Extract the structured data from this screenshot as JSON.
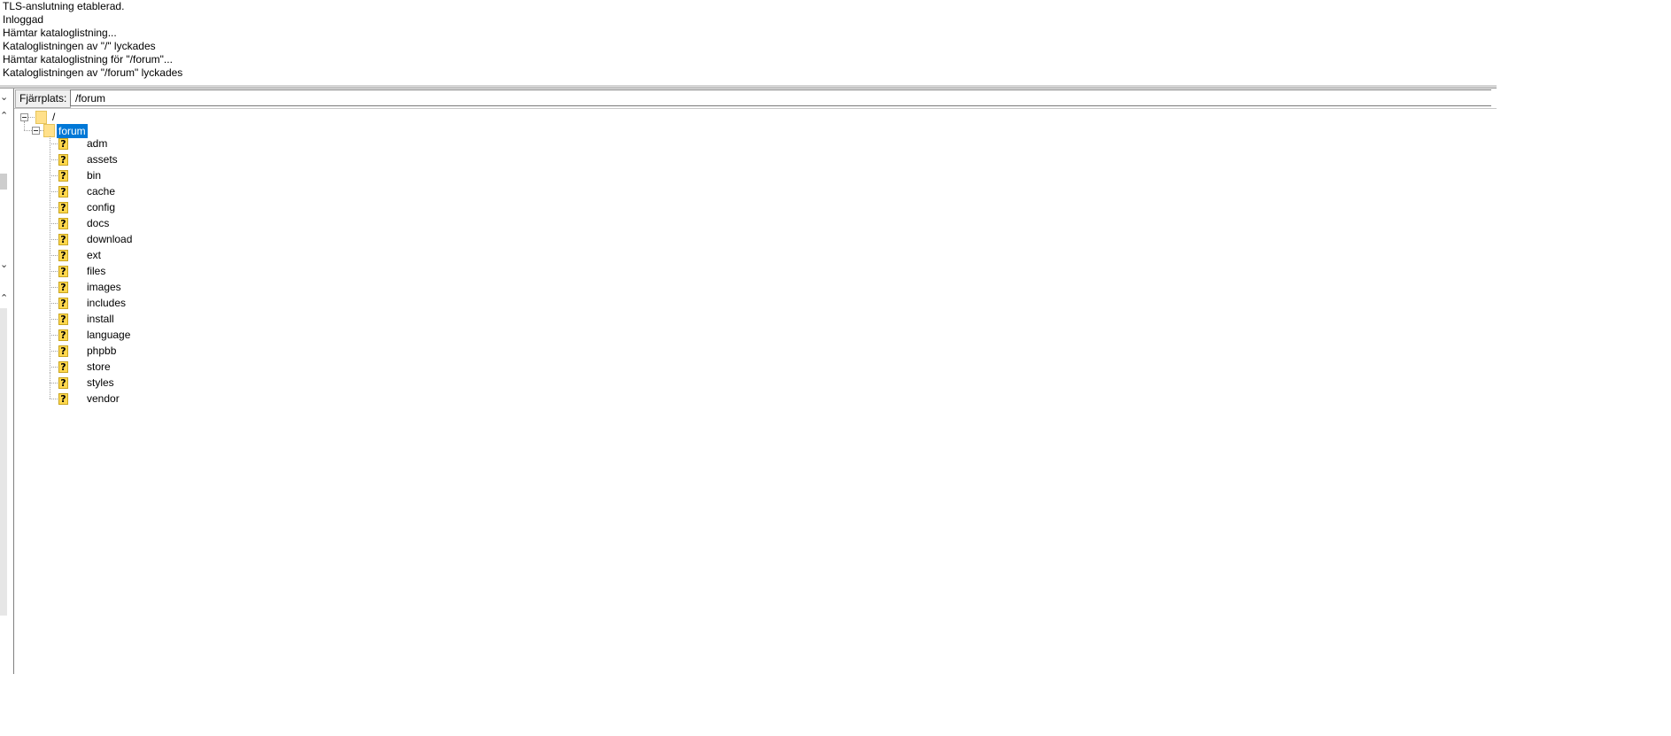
{
  "log": {
    "lines": [
      "TLS-anslutning etablerad.",
      "Inloggad",
      "Hämtar kataloglistning...",
      "Kataloglistningen av \"/\" lyckades",
      "Hämtar kataloglistning för \"/forum\"...",
      "Kataloglistningen av \"/forum\" lyckades"
    ]
  },
  "remote": {
    "path_label": "Fjärrplats:",
    "path_value": "/forum"
  },
  "tree": {
    "root": {
      "label": "/",
      "icon": "folder-icon"
    },
    "forum": {
      "label": "forum",
      "icon": "folder-icon",
      "selected": true
    },
    "children": [
      {
        "label": "adm",
        "icon": "unknown-folder-icon"
      },
      {
        "label": "assets",
        "icon": "unknown-folder-icon"
      },
      {
        "label": "bin",
        "icon": "unknown-folder-icon"
      },
      {
        "label": "cache",
        "icon": "unknown-folder-icon"
      },
      {
        "label": "config",
        "icon": "unknown-folder-icon"
      },
      {
        "label": "docs",
        "icon": "unknown-folder-icon"
      },
      {
        "label": "download",
        "icon": "unknown-folder-icon"
      },
      {
        "label": "ext",
        "icon": "unknown-folder-icon"
      },
      {
        "label": "files",
        "icon": "unknown-folder-icon"
      },
      {
        "label": "images",
        "icon": "unknown-folder-icon"
      },
      {
        "label": "includes",
        "icon": "unknown-folder-icon"
      },
      {
        "label": "install",
        "icon": "unknown-folder-icon"
      },
      {
        "label": "language",
        "icon": "unknown-folder-icon"
      },
      {
        "label": "phpbb",
        "icon": "unknown-folder-icon"
      },
      {
        "label": "store",
        "icon": "unknown-folder-icon"
      },
      {
        "label": "styles",
        "icon": "unknown-folder-icon"
      },
      {
        "label": "vendor",
        "icon": "unknown-folder-icon"
      }
    ]
  },
  "colors": {
    "selection": "#0078d7",
    "folder": "#ffe08a",
    "unknown_icon": "#ffd84d"
  }
}
